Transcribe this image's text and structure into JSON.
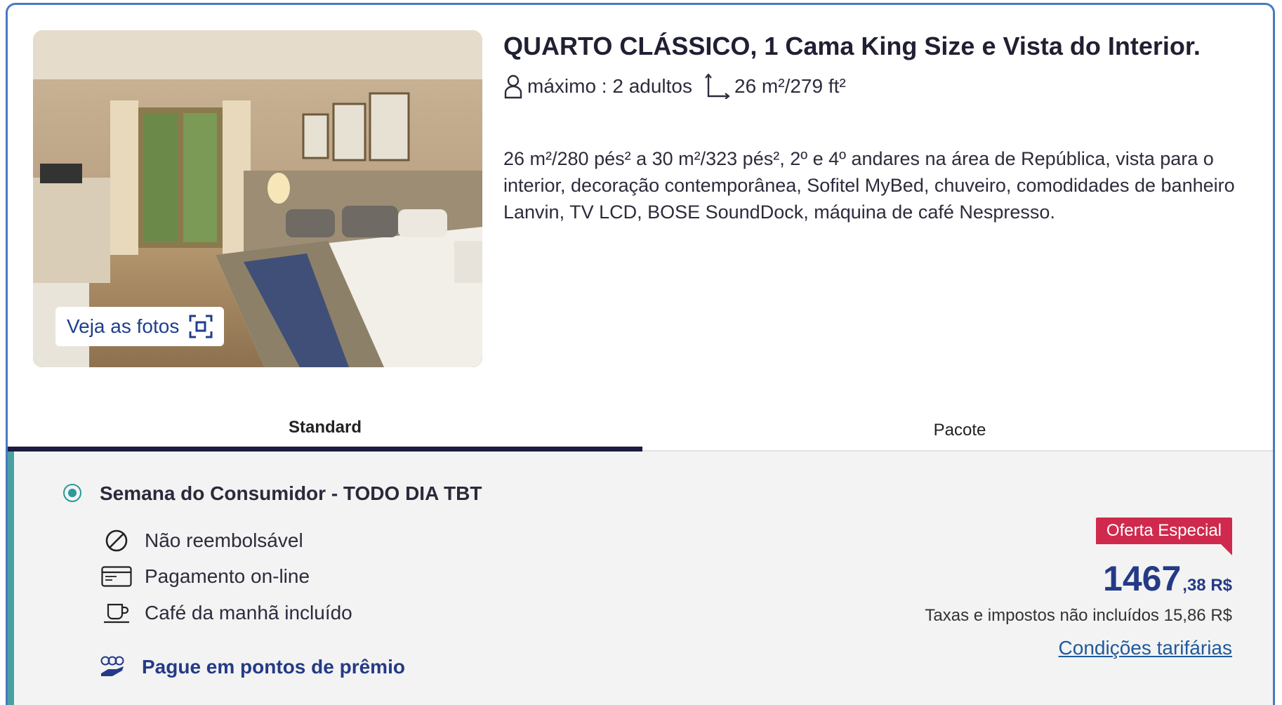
{
  "room": {
    "title": "QUARTO CLÁSSICO, 1 Cama King Size e Vista do Interior.",
    "max_guests": "máximo : 2 adultos",
    "size": "26 m²/279 ft²",
    "description": "26 m²/280 pés² a 30 m²/323 pés², 2º e 4º andares na área de República, vista para o interior, decoração contemporânea, Sofitel MyBed, chuveiro, comodidades de banheiro Lanvin, TV LCD, BOSE SoundDock, máquina de café Nespresso.",
    "photos_button": "Veja as fotos"
  },
  "tabs": [
    {
      "label": "Standard",
      "active": true
    },
    {
      "label": "Pacote",
      "active": false
    }
  ],
  "rate": {
    "name": "Semana do Consumidor - TODO DIA TBT",
    "selected": true,
    "features": [
      {
        "icon": "no-refund-icon",
        "label": "Não reembolsável"
      },
      {
        "icon": "credit-card-icon",
        "label": "Pagamento on-line"
      },
      {
        "icon": "coffee-cup-icon",
        "label": "Café da manhã incluído"
      }
    ],
    "points_link": "Pague em pontos de prêmio",
    "badge": "Oferta Especial",
    "price_integer": "1467",
    "price_decimal": ",38 R$",
    "taxes_note": "Taxas e impostos não incluídos 15,86 R$",
    "conditions_link": "Condições tarifárias"
  },
  "colors": {
    "accent": "#243a86",
    "badge": "#cf2a4d",
    "teal": "#2b9a98",
    "border": "#4a78c4"
  }
}
